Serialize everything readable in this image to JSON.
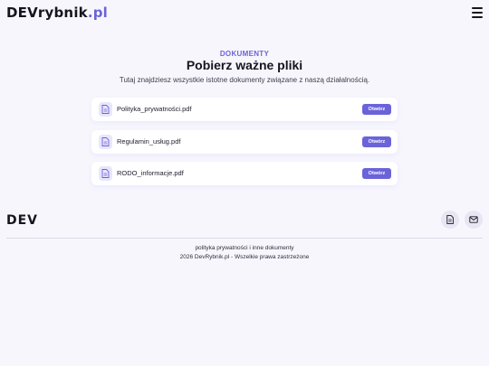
{
  "header": {
    "brand_dev": "DEV",
    "brand_rest": "rybnik",
    "brand_tld": ".pl",
    "menu_icon": "hamburger-menu-icon"
  },
  "hero": {
    "eyebrow": "DOKUMENTY",
    "title": "Pobierz ważne pliki",
    "subtitle": "Tutaj znajdziesz wszystkie istotne dokumenty związane z naszą działalnością."
  },
  "documents": [
    {
      "name": "Polityka_prywatności.pdf",
      "button": "Otwórz",
      "icon": "file-icon"
    },
    {
      "name": "Regulamin_usług.pdf",
      "button": "Otwórz",
      "icon": "file-icon"
    },
    {
      "name": "RODO_informacje.pdf",
      "button": "Otwórz",
      "icon": "file-icon"
    }
  ],
  "footer": {
    "logo": "DEV",
    "icons": [
      "document-icon",
      "mail-icon"
    ],
    "line1": "polityka prywatności i inne dokumenty",
    "line2": "2026 DevRybnik.pl - Wszelkie prawa zastrzeżone"
  },
  "colors": {
    "accent": "#6b63d9",
    "background": "#f7f6fd",
    "card": "#ffffff",
    "icon_bg": "#e8e6fb"
  }
}
